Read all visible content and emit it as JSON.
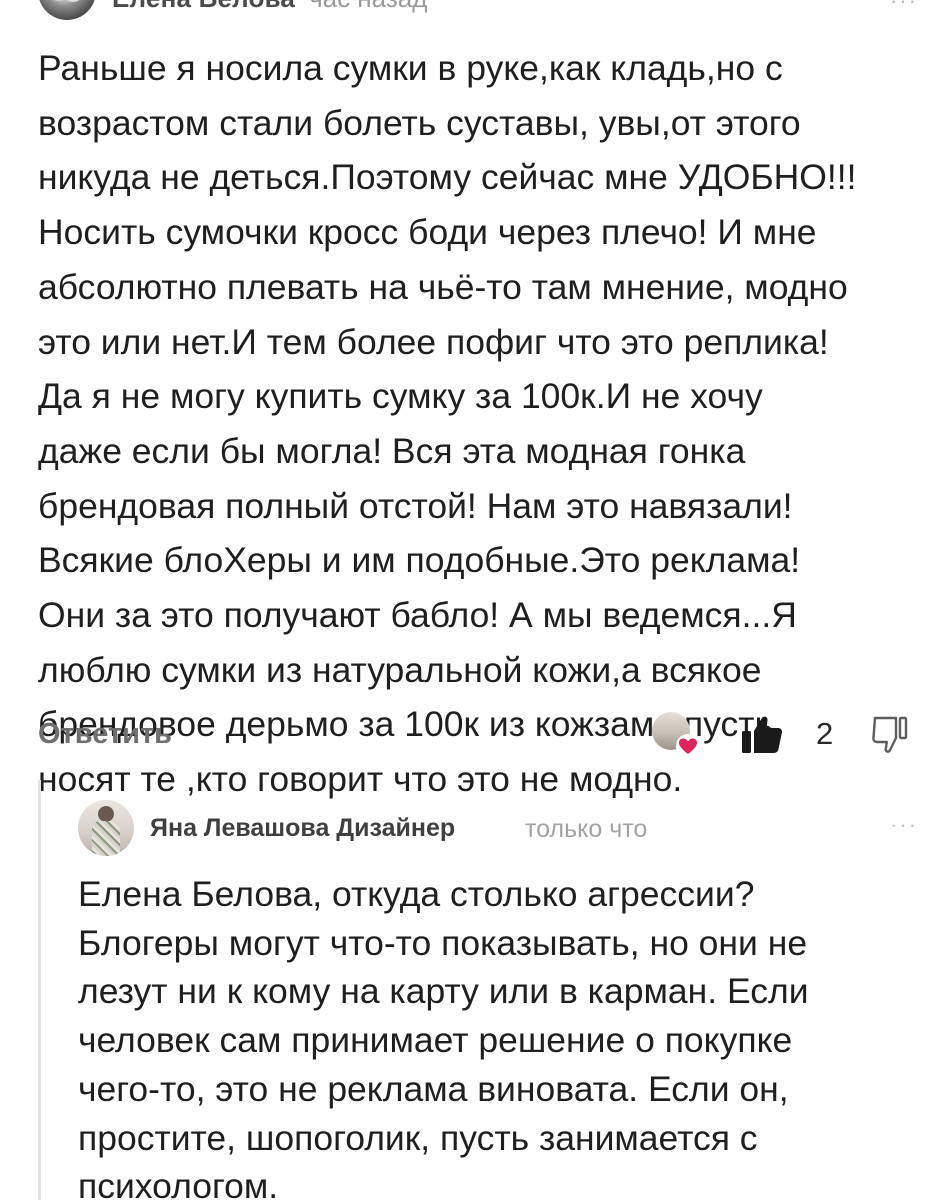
{
  "comment": {
    "author": "Елена Белова",
    "time": "час назад",
    "menu_label": "···",
    "lines": [
      "Раньше я носила сумки в руке,как кладь,но с",
      "возрастом стали болеть суставы, увы,от этого",
      "никуда не деться.Поэтому сейчас мне УДОБНО!!!",
      "Носить сумочки кросс боди через плечо! И мне",
      "абсолютно плевать на чьё-то там мнение, модно",
      "это или нет.И тем более пофиг что это реплика!",
      "Да я не могу купить сумку за 100к.И не хочу",
      "даже если бы могла! Вся эта модная гонка",
      "брендовая полный отстой! Нам это навязали!",
      "Всякие блоХеры и им подобные.Это реклама!",
      "Они за это получают бабло! А мы ведемся...Я",
      "люблю сумки из натуральной кожи,а всякое",
      "брендовое дерьмо за 100к из кожзама пусть",
      "носят те ,кто говорит что это не модно."
    ],
    "reply_label": "Ответить",
    "like_count": "2",
    "heart_color": "#e0245e"
  },
  "reply": {
    "author": "Яна Левашова Дизайнер",
    "time": "только что",
    "menu_label": "···",
    "lines": [
      "Елена Белова, откуда столько агрессии?",
      "Блогеры могут что-то показывать, но они не",
      "лезут ни к кому на карту или в карман. Если",
      "человек сам принимает решение о покупке",
      "чего-то, это не реклама виновата. Если он,",
      "простите, шопоголик, пусть занимается с",
      "психологом."
    ]
  }
}
